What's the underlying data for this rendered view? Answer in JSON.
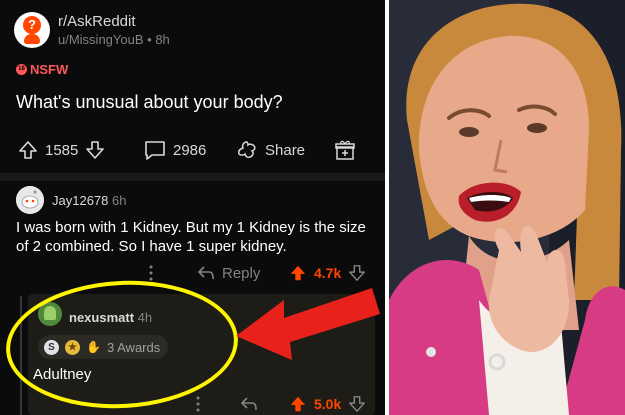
{
  "post": {
    "subreddit": "r/AskReddit",
    "author": "u/MissingYouB",
    "age": "8h",
    "nsfw_label": "NSFW",
    "title": "What's unusual about your body?",
    "upvotes": "1585",
    "comments": "2986",
    "share_label": "Share"
  },
  "comments": [
    {
      "user": "Jay12678",
      "age": "6h",
      "text": "I was born with 1 Kidney. But my 1 Kidney is the size of 2 combined. So I have 1 super kidney.",
      "reply_label": "Reply",
      "score": "4.7k"
    },
    {
      "user": "nexusmatt",
      "age": "4h",
      "awards_label": "3 Awards",
      "text": "Adultney",
      "score": "5.0k"
    }
  ],
  "colors": {
    "background": "#0b0b0b",
    "upvote": "#ff4500",
    "nsfw": "#ff585b",
    "highlight_circle": "#fff500",
    "arrow": "#e8211a",
    "jacket": "#d63b83"
  },
  "icons": [
    "upvote-icon",
    "downvote-icon",
    "comment-icon",
    "share-icon",
    "award-gift-icon",
    "more-icon",
    "reply-icon"
  ]
}
